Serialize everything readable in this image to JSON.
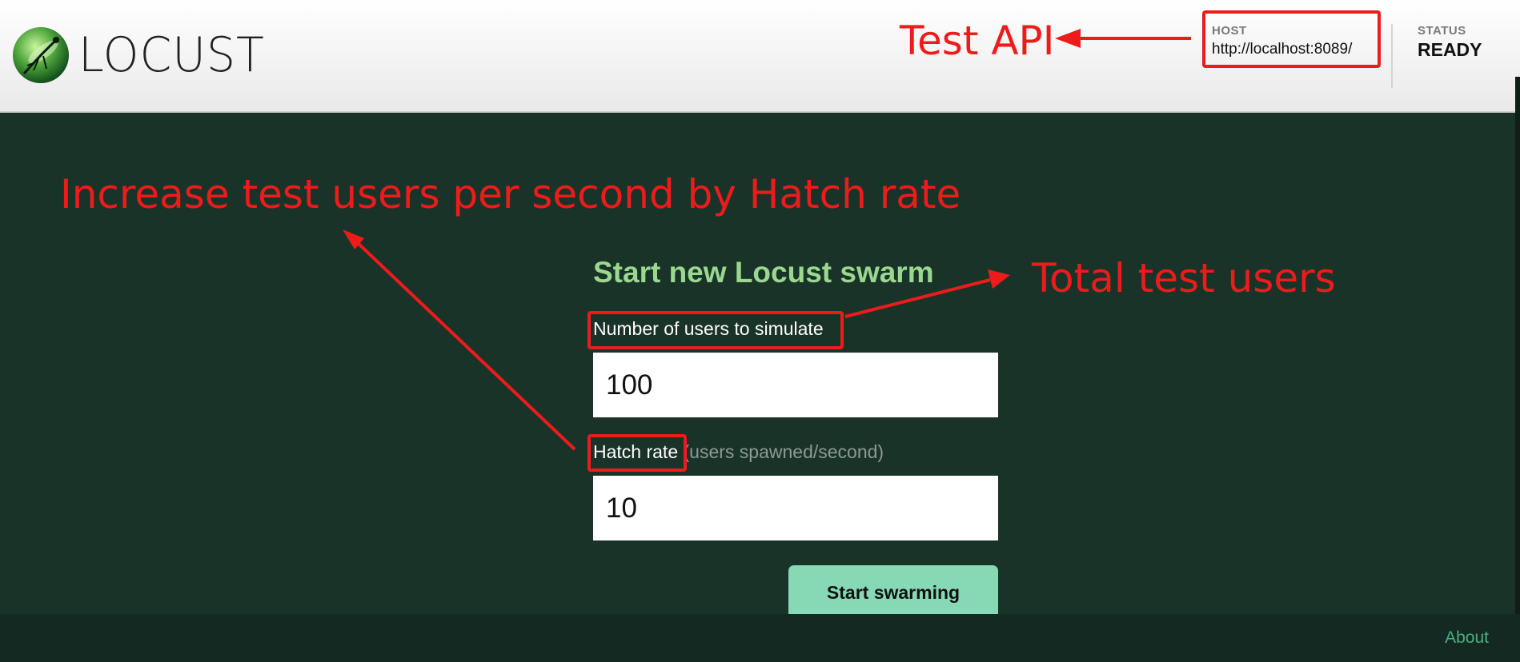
{
  "header": {
    "logo_text": "LOCUST",
    "host_label": "HOST",
    "host_value": "http://localhost:8089/",
    "status_label": "STATUS",
    "status_value": "READY"
  },
  "form": {
    "title": "Start new Locust swarm",
    "users_label": "Number of users to simulate",
    "users_value": "100",
    "hatch_label": "Hatch rate",
    "hatch_note": "(users spawned/second)",
    "hatch_value": "10",
    "submit_label": "Start swarming"
  },
  "footer": {
    "about_label": "About"
  },
  "annotations": {
    "test_api": "Test API",
    "hatch_rate_note": "Increase test users per second by Hatch rate",
    "total_users_note": "Total test users"
  },
  "colors": {
    "page_bg": "#1a3329",
    "title_green": "#9bd88f",
    "button_green": "#87d9b6",
    "annotation_red": "#ee1b1b"
  },
  "icons": {
    "logo": "locust-logo-icon"
  }
}
